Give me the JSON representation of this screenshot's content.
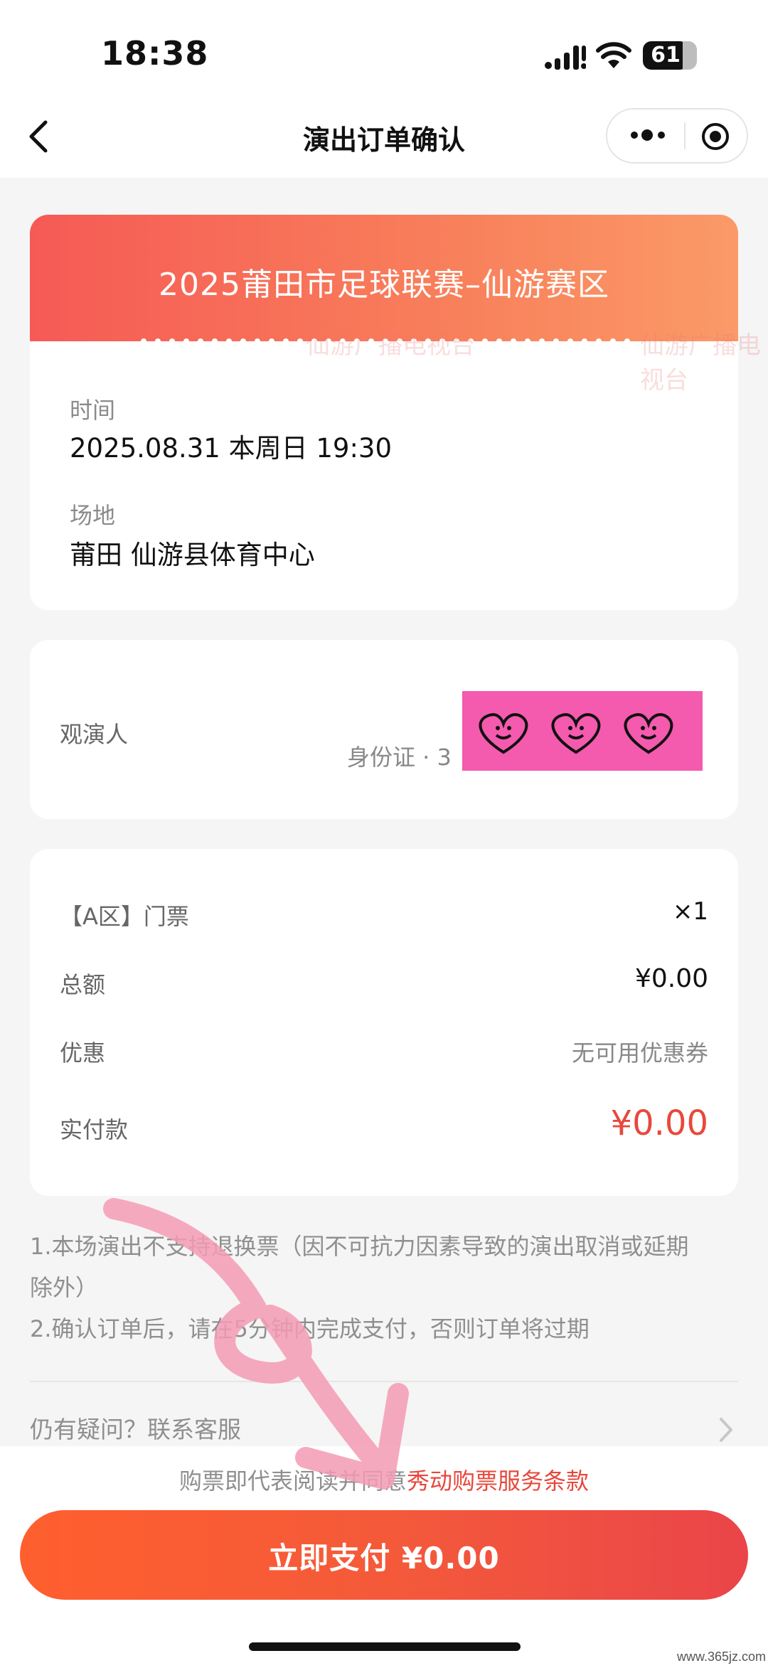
{
  "status_bar": {
    "time": "18:38",
    "battery": "61",
    "icons": [
      "signal-icon",
      "wifi-icon",
      "battery-icon"
    ]
  },
  "nav": {
    "title": "演出订单确认",
    "icons": [
      "back-icon",
      "more-icon",
      "target-icon"
    ]
  },
  "event": {
    "title": "2025莆田市足球联赛–仙游赛区"
  },
  "info": {
    "time_label": "时间",
    "time_value": "2025.08.31 本周日 19:30",
    "venue_label": "场地",
    "venue_value": "莆田 仙游县体育中心"
  },
  "viewer": {
    "label": "观演人",
    "id_text": "身份证 · 3"
  },
  "price": {
    "ticket_label": "【A区】门票",
    "ticket_qty": "×1",
    "total_label": "总额",
    "total_value": "¥0.00",
    "discount_label": "优惠",
    "discount_value": "无可用优惠券",
    "paid_label": "实付款",
    "paid_value": "¥0.00"
  },
  "notes": {
    "line1": "1.本场演出不支持退换票（因不可抗力因素导致的演出取消或延期",
    "line1b": "除外）",
    "line2": "2.确认订单后，请在5分钟内完成支付，否则订单将过期"
  },
  "contact": {
    "label": "仍有疑问？联系客服"
  },
  "terms": {
    "prefix": "购票即代表阅读并同意",
    "link": "秀动购票服务条款"
  },
  "pay": {
    "label": "立即支付 ¥0.00"
  },
  "watermark": {
    "text": "仙游广播电视台",
    "site": "www.365jz.com"
  },
  "colors": {
    "accent": "#f45a3a",
    "price_red": "#e8483c",
    "sticker_pink": "#f45aad"
  }
}
